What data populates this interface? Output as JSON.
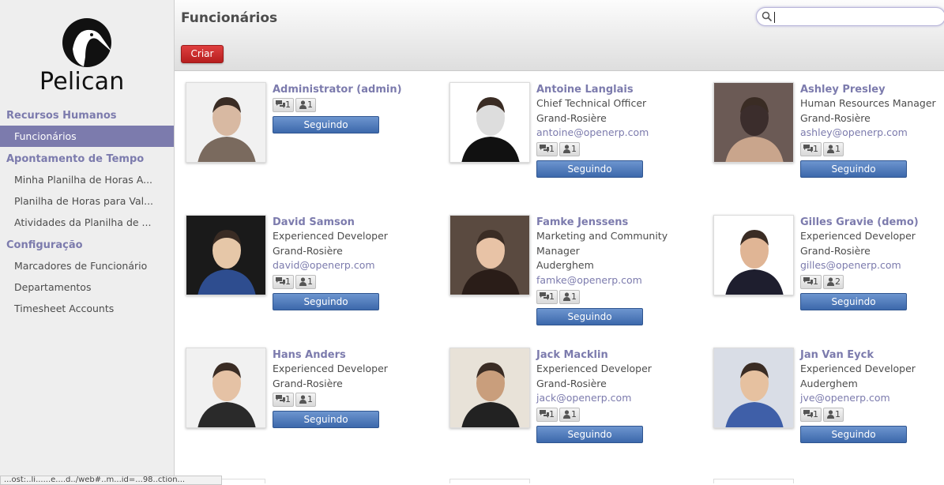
{
  "brand": {
    "name": "Pelican"
  },
  "sidebar": {
    "sections": [
      {
        "label": "Recursos Humanos",
        "items": [
          {
            "label": "Funcionários",
            "active": true
          }
        ]
      },
      {
        "label": "Apontamento de Tempo",
        "items": [
          {
            "label": "Minha Planilha de Horas A..."
          },
          {
            "label": "Planilha de Horas para Val..."
          },
          {
            "label": "Atividades da Planilha de ..."
          }
        ]
      },
      {
        "label": "Configuração",
        "items": [
          {
            "label": "Marcadores de Funcionário"
          },
          {
            "label": "Departamentos"
          },
          {
            "label": "Timesheet Accounts"
          }
        ]
      }
    ]
  },
  "header": {
    "title": "Funcionários",
    "create_label": "Criar"
  },
  "search": {
    "value": "",
    "icon": "search-icon"
  },
  "colors": {
    "accent": "#7c7bad",
    "create": "#c62828",
    "follow": "#4a74b5"
  },
  "employees": [
    {
      "name": "Administrator (admin)",
      "lines": [],
      "email": "",
      "messages": "1",
      "followers": "1",
      "button": "Seguindo"
    },
    {
      "name": "Antoine Langlais",
      "lines": [
        "Chief Technical Officer",
        "Grand-Rosière"
      ],
      "email": "antoine@openerp.com",
      "messages": "1",
      "followers": "1",
      "button": "Seguindo"
    },
    {
      "name": "Ashley Presley",
      "lines": [
        "Human Resources Manager",
        "Grand-Rosière"
      ],
      "email": "ashley@openerp.com",
      "messages": "1",
      "followers": "1",
      "button": "Seguindo"
    },
    {
      "name": "David Samson",
      "lines": [
        "Experienced Developer",
        "Grand-Rosière"
      ],
      "email": "david@openerp.com",
      "messages": "1",
      "followers": "1",
      "button": "Seguindo"
    },
    {
      "name": "Famke Jenssens",
      "lines": [
        "Marketing and Community",
        "Manager",
        "Auderghem"
      ],
      "email": "famke@openerp.com",
      "messages": "1",
      "followers": "1",
      "button": "Seguindo"
    },
    {
      "name": "Gilles Gravie (demo)",
      "lines": [
        "Experienced Developer",
        "Grand-Rosière"
      ],
      "email": "gilles@openerp.com",
      "messages": "1",
      "followers": "2",
      "button": "Seguindo"
    },
    {
      "name": "Hans Anders",
      "lines": [
        "Experienced Developer",
        "Grand-Rosière"
      ],
      "email": "",
      "messages": "1",
      "followers": "1",
      "button": "Seguindo"
    },
    {
      "name": "Jack Macklin",
      "lines": [
        "Experienced Developer",
        "Grand-Rosière"
      ],
      "email": "jack@openerp.com",
      "messages": "1",
      "followers": "1",
      "button": "Seguindo"
    },
    {
      "name": "Jan Van Eyck",
      "lines": [
        "Experienced Developer",
        "Auderghem"
      ],
      "email": "jve@openerp.com",
      "messages": "1",
      "followers": "1",
      "button": "Seguindo"
    }
  ],
  "status_bar": {
    "text": "...ost:..li......e....d../web#..m...id=...98..ction..."
  }
}
